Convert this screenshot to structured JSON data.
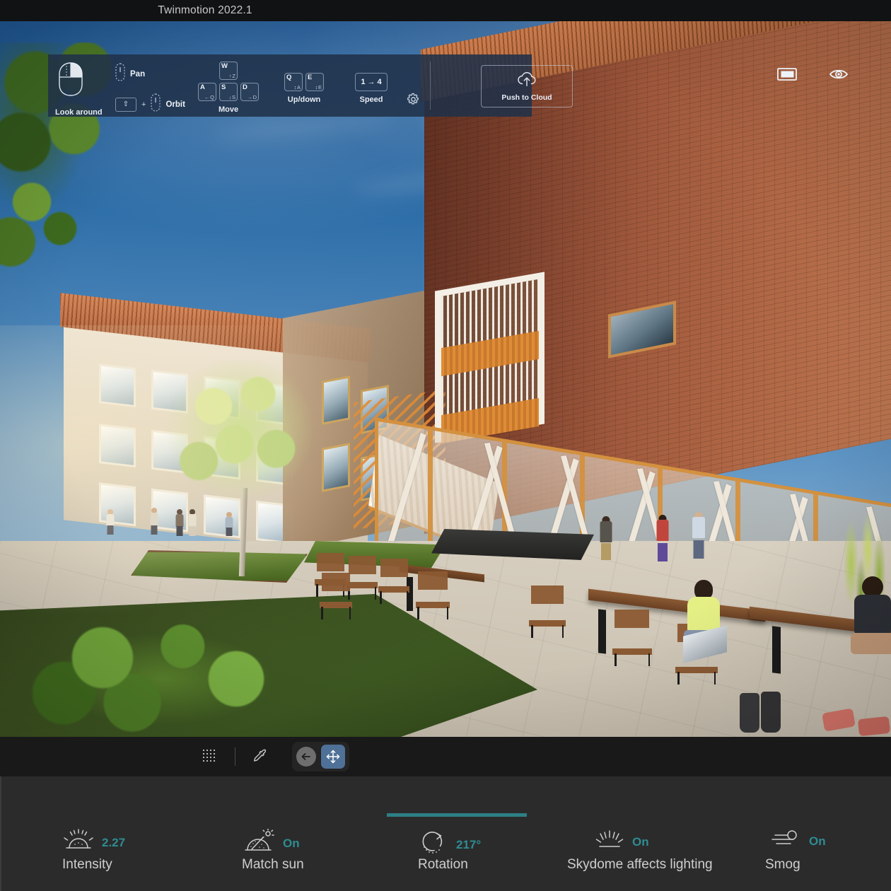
{
  "window": {
    "title": "Twinmotion 2022.1"
  },
  "nav_help": {
    "look_around": {
      "label": "Look around",
      "icon": "mouse-right-button-icon"
    },
    "pan": {
      "label": "Pan",
      "icon": "mouse-middle-button-icon"
    },
    "orbit": {
      "label": "Orbit",
      "icon": "mouse-middle-button-icon",
      "modifier": "⇧",
      "plus": "+"
    },
    "move": {
      "label": "Move",
      "keys": [
        {
          "primary": "W",
          "arrow": "↑",
          "alt": "Z"
        },
        {
          "primary": "A",
          "arrow": "←",
          "alt": "Q"
        },
        {
          "primary": "S",
          "arrow": "↓",
          "alt": "S"
        },
        {
          "primary": "D",
          "arrow": "→",
          "alt": "D"
        }
      ]
    },
    "updown": {
      "label": "Up/down",
      "keys": [
        {
          "primary": "Q",
          "arrow": "↕",
          "alt": "A"
        },
        {
          "primary": "E",
          "arrow": "↕",
          "alt": "E"
        }
      ]
    },
    "speed": {
      "label": "Speed",
      "value": "1 → 4"
    },
    "settings_icon": "gear-icon",
    "push_to_cloud": {
      "label": "Push to Cloud",
      "icon": "cloud-upload-icon"
    }
  },
  "viewport_overlay": {
    "panel_toggle_icon": "panel-layout-icon",
    "visibility_icon": "eye-icon"
  },
  "toolbar": {
    "grid_icon": "dot-grid-icon",
    "eyedropper_icon": "eyedropper-icon",
    "back_icon": "back-arrow-icon",
    "move_tool_icon": "move-gizmo-icon",
    "move_tool_active": true,
    "accent_blue": "#4f7097"
  },
  "properties": {
    "accent_teal": "#2f8c92",
    "items": [
      {
        "icon": "skydome-intensity-icon",
        "value": "2.27",
        "label": "Intensity",
        "slider": false
      },
      {
        "icon": "match-sun-icon",
        "value": "On",
        "label": "Match sun",
        "slider": false
      },
      {
        "icon": "rotation-icon",
        "value": "217°",
        "label": "Rotation",
        "slider": true
      },
      {
        "icon": "skydome-lighting-icon",
        "value": "On",
        "label": "Skydome affects lighting",
        "slider": false
      },
      {
        "icon": "smog-icon",
        "value": "On",
        "label": "Smog",
        "slider": false
      }
    ]
  }
}
